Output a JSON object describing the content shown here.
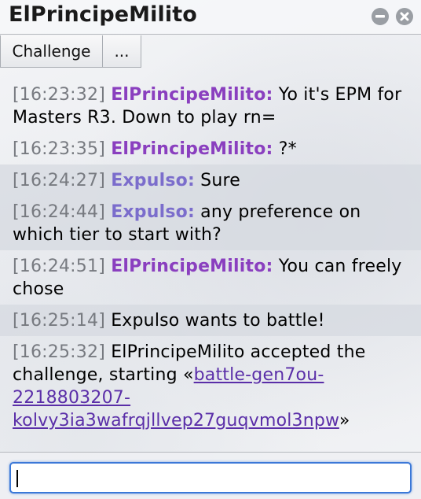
{
  "window": {
    "title": "ElPrincipeMilito",
    "minimize_icon": "minimize-icon",
    "close_icon": "close-icon"
  },
  "toolbar": {
    "challenge_label": "Challenge",
    "more_label": "..."
  },
  "colors": {
    "user_elprincipe": "#8a3fbf",
    "user_expulso": "#7b6dcc",
    "link": "#5a2ea8",
    "timestamp": "#777a80",
    "input_focus": "#3b78d8"
  },
  "messages": [
    {
      "time": "[16:23:32]",
      "user": "ElPrincipeMilito:",
      "text": "Yo it's EPM for Masters R3. Down to play rn="
    },
    {
      "time": "[16:23:35]",
      "user": "ElPrincipeMilito:",
      "text": "?*"
    },
    {
      "time": "[16:24:27]",
      "user": "Expulso:",
      "text": "Sure"
    },
    {
      "time": "[16:24:44]",
      "user": "Expulso:",
      "text": "any preference on which tier to start with?"
    },
    {
      "time": "[16:24:51]",
      "user": "ElPrincipeMilito:",
      "text": "You can freely chose"
    },
    {
      "time": "[16:25:14]",
      "text": "Expulso wants to battle!"
    },
    {
      "time": "[16:25:32]",
      "text_before": "ElPrincipeMilito accepted the challenge, starting «",
      "link": "battle-gen7ou-2218803207-kolvy3ia3wafrqjllvep27guqvmol3npw",
      "text_after": "»"
    }
  ],
  "input": {
    "value": "",
    "placeholder": ""
  }
}
